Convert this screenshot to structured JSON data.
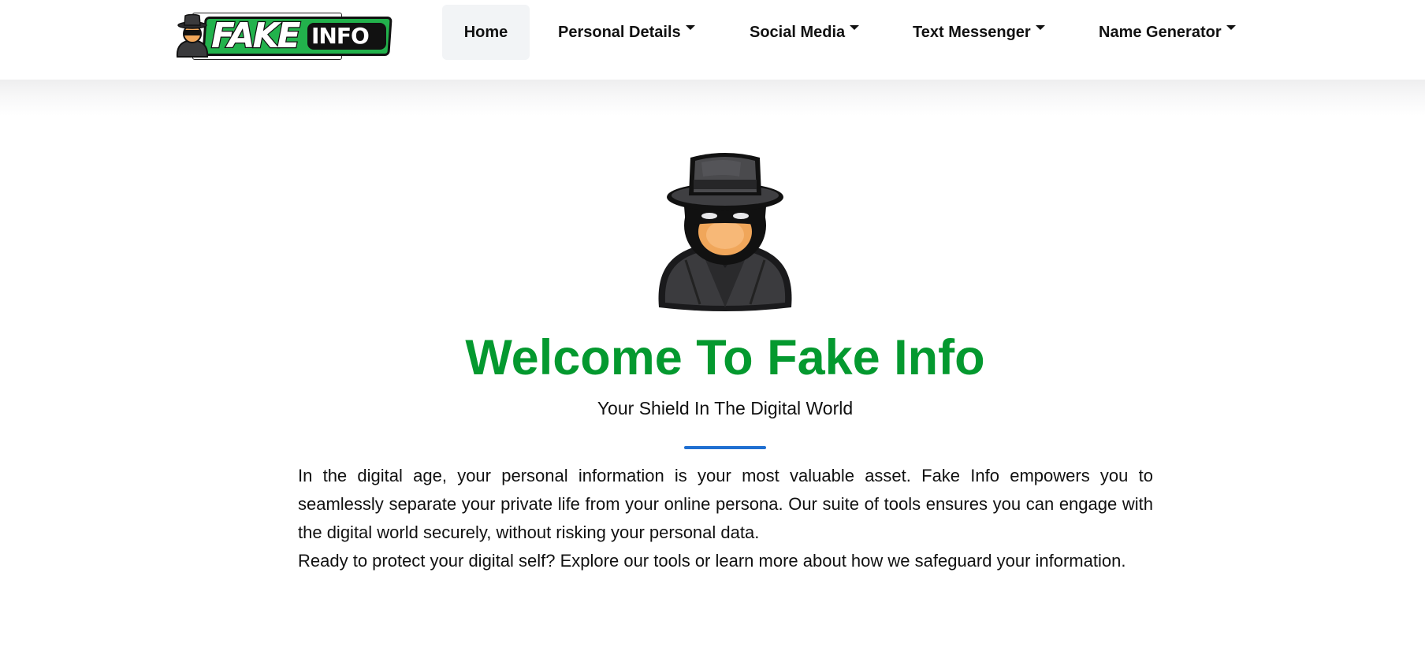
{
  "brand": {
    "logo_text_primary": "FAKE",
    "logo_text_secondary": "INFO",
    "logo_icon": "spy-icon",
    "colors": {
      "green": "#22b24c",
      "dark": "#111111"
    }
  },
  "nav": {
    "items": [
      {
        "label": "Home",
        "active": true,
        "dropdown": false
      },
      {
        "label": "Personal Details",
        "active": false,
        "dropdown": true
      },
      {
        "label": "Social Media",
        "active": false,
        "dropdown": true
      },
      {
        "label": "Text Messenger",
        "active": false,
        "dropdown": true
      },
      {
        "label": "Name Generator",
        "active": false,
        "dropdown": true
      }
    ],
    "caret_icon": "caret-down-icon"
  },
  "hero": {
    "icon": "spy-icon",
    "title": "Welcome To Fake Info",
    "subtitle": "Your Shield In The Digital World",
    "description": "In the digital age, your personal information is your most valuable asset. Fake Info empowers you to seamlessly separate your private life from your online persona. Our suite of tools ensures you can engage with the digital world securely, without risking your personal data.",
    "cta_text": "Ready to protect your digital self? Explore our tools or learn more about how we safeguard your information.",
    "colors": {
      "title": "#04992f",
      "divider": "#1f6fd1"
    }
  }
}
